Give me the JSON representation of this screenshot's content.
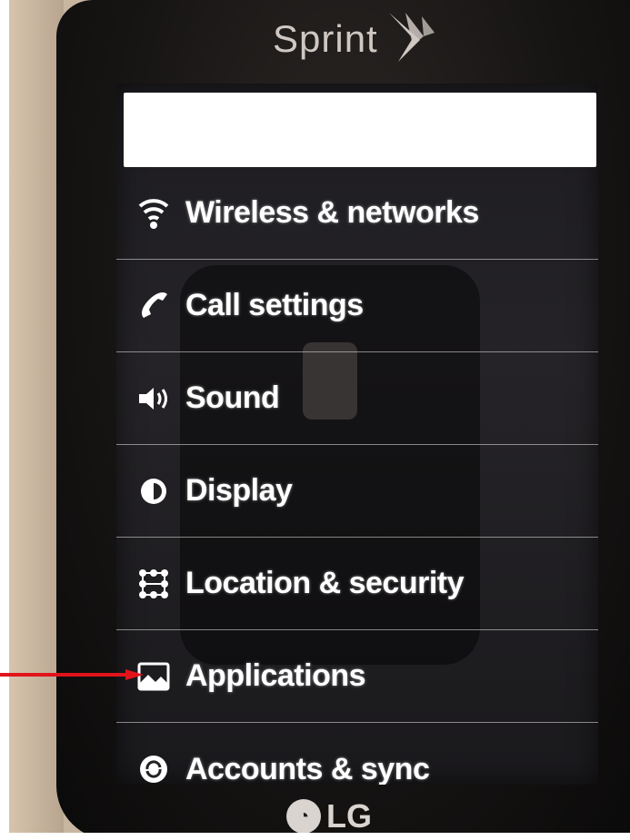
{
  "carrier": {
    "name": "Sprint"
  },
  "manufacturer": {
    "name": "LG"
  },
  "topbar": {
    "text": ""
  },
  "settings_menu": {
    "items": [
      {
        "label": "Wireless & networks",
        "icon": "wifi-icon"
      },
      {
        "label": "Call settings",
        "icon": "phone-icon"
      },
      {
        "label": "Sound",
        "icon": "speaker-icon"
      },
      {
        "label": "Display",
        "icon": "brightness-icon"
      },
      {
        "label": "Location & security",
        "icon": "location-grid-icon"
      },
      {
        "label": "Applications",
        "icon": "applications-icon"
      },
      {
        "label": "Accounts & sync",
        "icon": "sync-icon"
      }
    ]
  },
  "annotation": {
    "arrow_color": "#e1141b",
    "target": "Applications"
  }
}
